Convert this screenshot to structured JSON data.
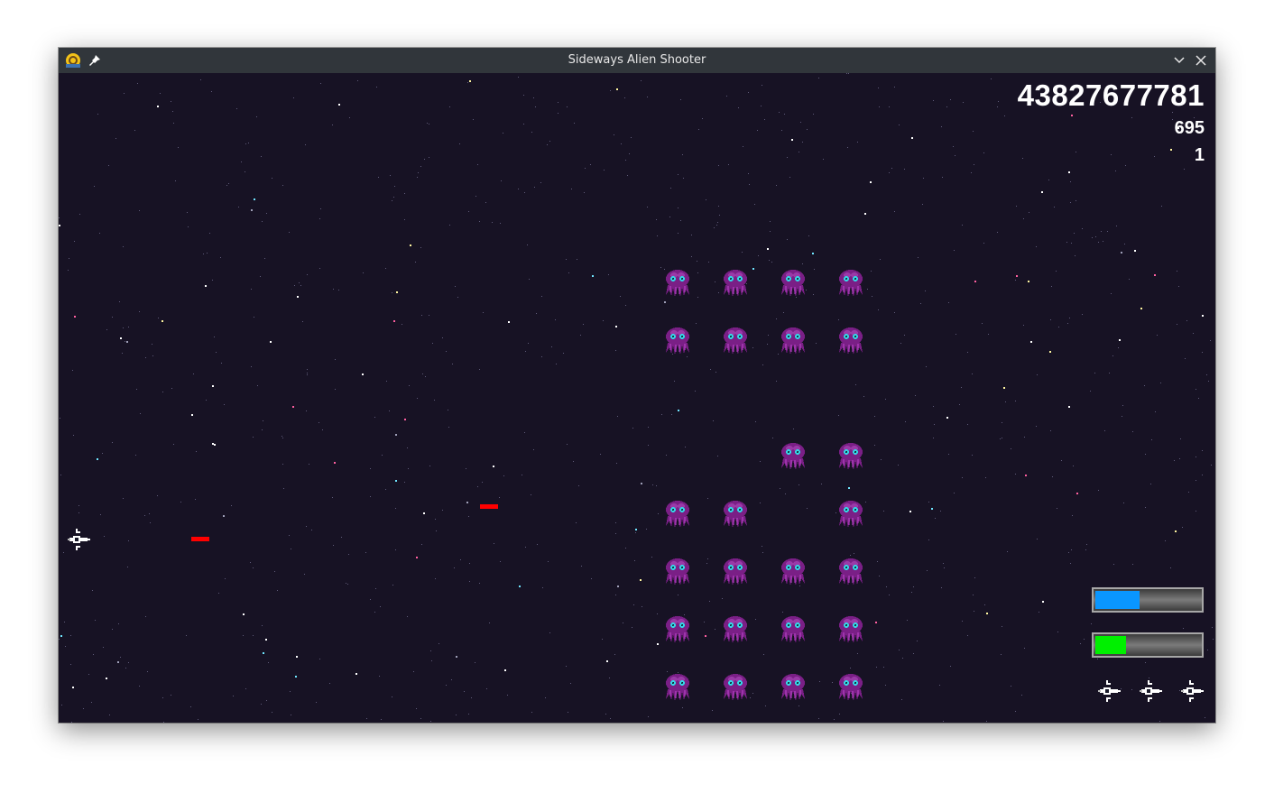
{
  "window": {
    "title": "Sideways Alien Shooter"
  },
  "titlebar_icons": [
    "app-icon",
    "pin-icon",
    "minimize-chevron-icon",
    "close-icon"
  ],
  "hud": {
    "score": "43827677781",
    "stat_1": "695",
    "stat_2": "1",
    "shield_bar": {
      "fraction": 0.42,
      "color": "#0a96ff"
    },
    "energy_bar": {
      "fraction": 0.29,
      "color": "#00f000"
    },
    "lives": 3
  },
  "aliens": {
    "color": "#7a1f86",
    "eye_color": "#35d6e6",
    "grid": [
      [
        true,
        true,
        true,
        true
      ],
      [
        true,
        true,
        true,
        true
      ],
      [
        false,
        false,
        false,
        false
      ],
      [
        false,
        false,
        true,
        true
      ],
      [
        true,
        true,
        false,
        true
      ],
      [
        true,
        true,
        true,
        true
      ],
      [
        true,
        true,
        true,
        true
      ],
      [
        true,
        true,
        true,
        true
      ]
    ]
  },
  "projectiles": {
    "count": 2,
    "color": "#ff0000"
  },
  "colors": {
    "background": "#171224",
    "titlebar": "#31363b"
  }
}
